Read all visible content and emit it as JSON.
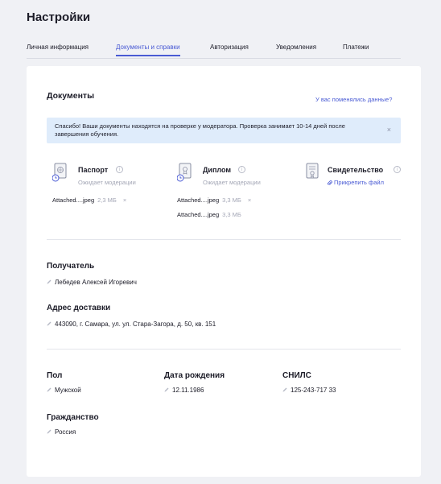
{
  "page": {
    "title": "Настройки"
  },
  "tabs": [
    {
      "label": "Личная информация",
      "active": false
    },
    {
      "label": "Документы и справки",
      "active": true
    },
    {
      "label": "Авторизация",
      "active": false
    },
    {
      "label": "Уведомления",
      "active": false
    },
    {
      "label": "Платежи",
      "active": false
    }
  ],
  "documents": {
    "title": "Документы",
    "change_link": "У вас поменялись данные?",
    "notice": {
      "text": "Спасибо! Ваши документы находятся на проверке у модератора. Проверка занимает 10-14 дней после завершения обучения.",
      "close": "×"
    },
    "items": [
      {
        "name": "Паспорт",
        "status": "Ожидает модерации",
        "icon": "passport-icon",
        "files": [
          {
            "name": "Attached....jpeg",
            "size": "2,3 МБ",
            "remove": "×"
          }
        ]
      },
      {
        "name": "Диплом",
        "status": "Ожидает модерации",
        "icon": "diploma-icon",
        "files": [
          {
            "name": "Attached....jpeg",
            "size": "3,3 МБ",
            "remove": "×"
          },
          {
            "name": "Attached....jpeg",
            "size": "3,3 МБ"
          }
        ]
      },
      {
        "name": "Свидетельство",
        "attach_label": "Прикрепить файл",
        "icon": "certificate-icon"
      }
    ]
  },
  "recipient": {
    "label": "Получатель",
    "value": "Лебедев Алексей Игоревич"
  },
  "address": {
    "label": "Адрес доставки",
    "value": "443090, г. Самара, ул. ул. Стара-Загора, д. 50, кв. 151"
  },
  "gender": {
    "label": "Пол",
    "value": "Мужской"
  },
  "birthdate": {
    "label": "Дата рождения",
    "value": "12.11.1986"
  },
  "snils": {
    "label": "СНИЛС",
    "value": "125-243-717 33"
  },
  "citizenship": {
    "label": "Гражданство",
    "value": "Россия"
  },
  "colors": {
    "accent": "#4a5bd4",
    "notice_bg": "#dfecfb",
    "page_bg": "#f0f1f5"
  }
}
